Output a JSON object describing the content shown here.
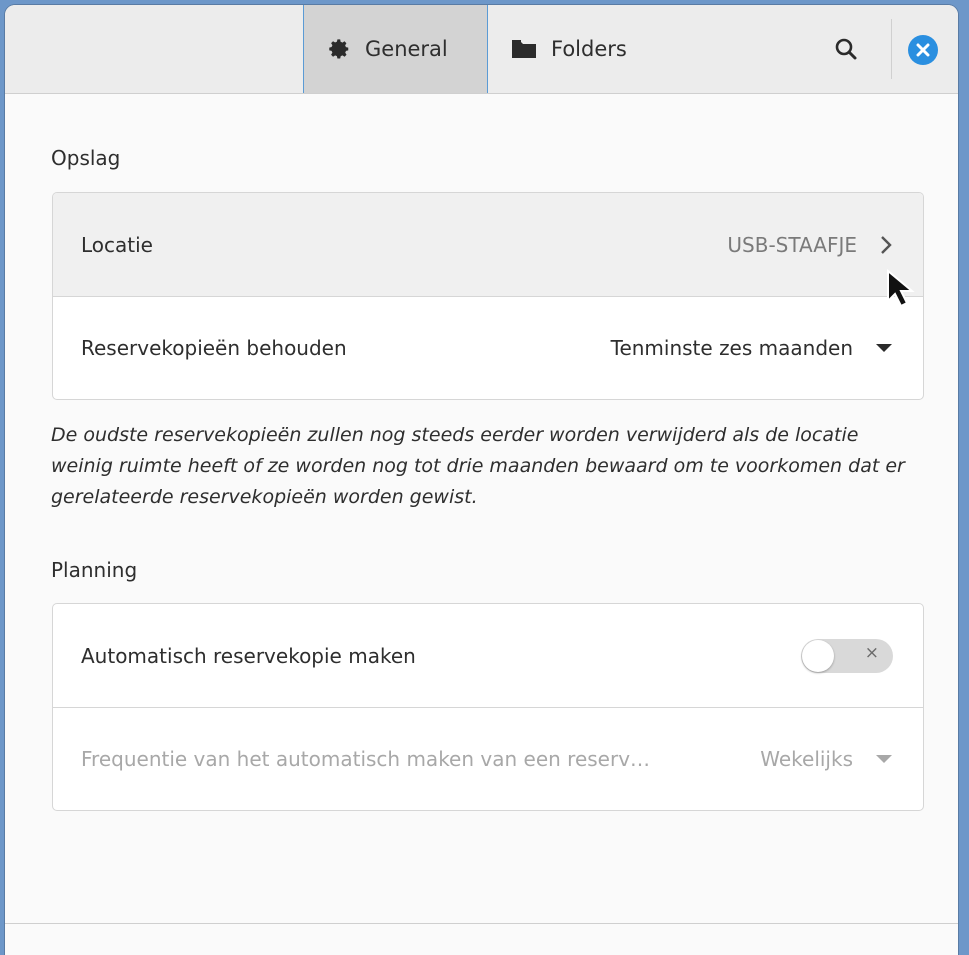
{
  "header": {
    "tabs": [
      {
        "label": "General",
        "icon": "gear-icon",
        "active": true
      },
      {
        "label": "Folders",
        "icon": "folder-icon",
        "active": false
      }
    ],
    "search_icon": "search-icon",
    "close_icon": "close-icon",
    "accent": "#2a8fe0"
  },
  "storage": {
    "title": "Opslag",
    "location": {
      "label": "Locatie",
      "value": "USB-STAAFJE"
    },
    "keep": {
      "label": "Reservekopieën behouden",
      "value": "Tenminste zes maanden"
    },
    "note": "De oudste reservekopieën zullen nog steeds eerder worden verwijderd als de locatie weinig ruimte heeft of ze worden nog tot drie maanden bewaard om te voorkomen dat er gerelateerde reservekopieën worden gewist."
  },
  "schedule": {
    "title": "Planning",
    "auto": {
      "label": "Automatisch reservekopie maken",
      "enabled": false
    },
    "frequency": {
      "label": "Frequentie van het automatisch maken van een reserv…",
      "value": "Wekelijks"
    }
  }
}
